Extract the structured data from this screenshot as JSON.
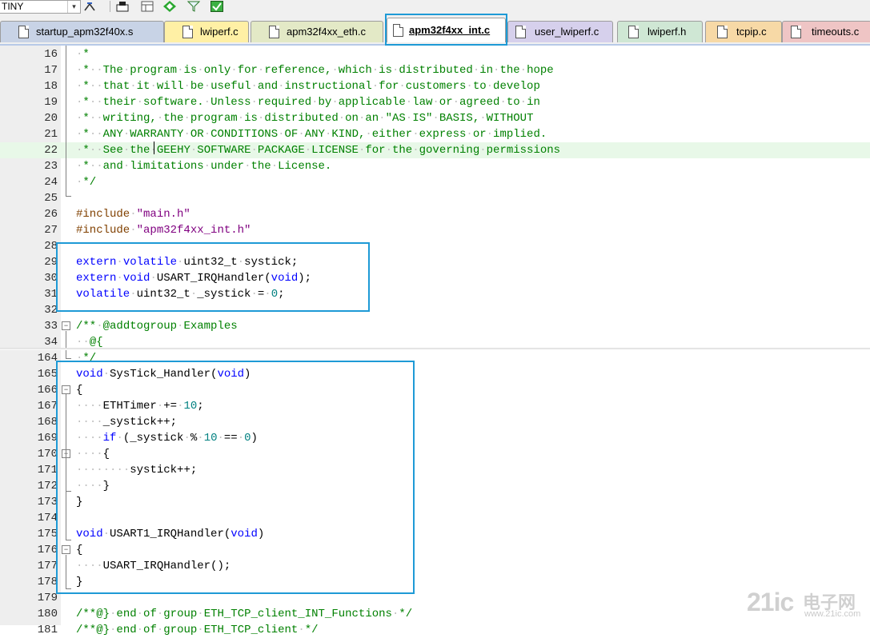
{
  "toolbar": {
    "combo_value": "TINY",
    "icons": [
      "dropdown-arrow-icon",
      "tools-icon",
      "build-icon",
      "layout-icon",
      "diamond-icon",
      "filter-icon",
      "green-checked-icon"
    ]
  },
  "tabs": [
    {
      "label": "startup_apm32f40x.s",
      "color": "#c8d3e6"
    },
    {
      "label": "lwiperf.c",
      "color": "#fff0a5"
    },
    {
      "label": "apm32f4xx_eth.c",
      "color": "#e3e9c6"
    },
    {
      "label": "apm32f4xx_int.c",
      "color": "#ffffff",
      "active": true
    },
    {
      "label": "user_lwiperf.c",
      "color": "#d6d0ec"
    },
    {
      "label": "lwiperf.h",
      "color": "#cfe7d4"
    },
    {
      "label": "tcpip.c",
      "color": "#f7d9a6"
    },
    {
      "label": "timeouts.c",
      "color": "#efc5c5"
    }
  ],
  "code_lines": [
    {
      "n": "16",
      "text": " *"
    },
    {
      "n": "17",
      "text": " *  The program is only for reference, which is distributed in the hope"
    },
    {
      "n": "18",
      "text": " *  that it will be useful and instructional for customers to develop"
    },
    {
      "n": "19",
      "text": " *  their software. Unless required by applicable law or agreed to in"
    },
    {
      "n": "20",
      "text": " *  writing, the program is distributed on an \"AS IS\" BASIS, WITHOUT"
    },
    {
      "n": "21",
      "text": " *  ANY WARRANTY OR CONDITIONS OF ANY KIND, either express or implied."
    },
    {
      "n": "22",
      "text": " *  See the GEEHY SOFTWARE PACKAGE LICENSE for the governing permissions"
    },
    {
      "n": "23",
      "text": " *  and limitations under the License."
    },
    {
      "n": "24",
      "text": " */"
    },
    {
      "n": "25",
      "text": ""
    },
    {
      "n": "26",
      "text": "#include \"main.h\""
    },
    {
      "n": "27",
      "text": "#include \"apm32f4xx_int.h\""
    },
    {
      "n": "28",
      "text": ""
    },
    {
      "n": "29",
      "text": "extern volatile uint32_t systick;"
    },
    {
      "n": "30",
      "text": "extern void USART_IRQHandler(void);"
    },
    {
      "n": "31",
      "text": "volatile uint32_t _systick = 0;"
    },
    {
      "n": "32",
      "text": ""
    },
    {
      "n": "33",
      "text": "/** @addtogroup Examples"
    },
    {
      "n": "34",
      "text": "  @{"
    },
    {
      "n": "164",
      "text": " */"
    },
    {
      "n": "165",
      "text": "void SysTick_Handler(void)"
    },
    {
      "n": "166",
      "text": "{"
    },
    {
      "n": "167",
      "text": "    ETHTimer += 10;"
    },
    {
      "n": "168",
      "text": "    _systick++;"
    },
    {
      "n": "169",
      "text": "    if (_systick % 10 == 0)"
    },
    {
      "n": "170",
      "text": "    {"
    },
    {
      "n": "171",
      "text": "        systick++;"
    },
    {
      "n": "172",
      "text": "    }"
    },
    {
      "n": "173",
      "text": "}"
    },
    {
      "n": "174",
      "text": ""
    },
    {
      "n": "175",
      "text": "void USART1_IRQHandler(void)"
    },
    {
      "n": "176",
      "text": "{"
    },
    {
      "n": "177",
      "text": "    USART_IRQHandler();"
    },
    {
      "n": "178",
      "text": "}"
    },
    {
      "n": "179",
      "text": ""
    },
    {
      "n": "180",
      "text": "/**@} end of group ETH_TCP_client_INT_Functions */"
    },
    {
      "n": "181",
      "text": "/**@} end of group ETH_TCP_client */"
    }
  ],
  "watermark": {
    "brand": "21ic",
    "cn": "电子网",
    "url": "www.21ic.com"
  },
  "colors": {
    "highlight_box": "#1e9ad6",
    "current_line": "#e8f8e8",
    "comment": "#008000",
    "keyword": "#0000ff",
    "preprocessor": "#804000",
    "string": "#800080",
    "number": "#008080"
  }
}
